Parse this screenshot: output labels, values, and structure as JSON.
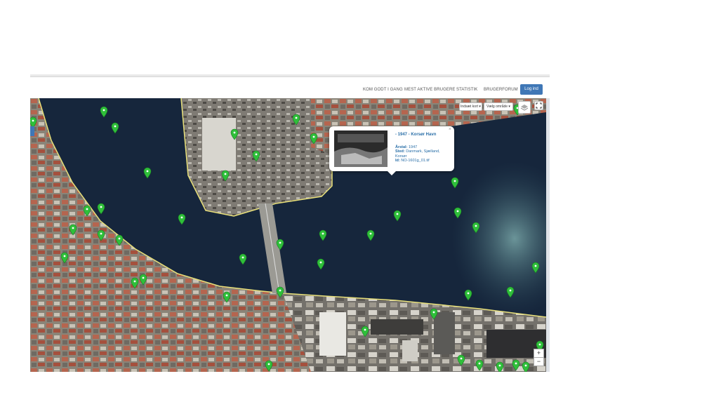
{
  "navbar": {
    "links": [
      "KOM GODT I GANG",
      "MEST AKTIVE BRUGERE",
      "STATISTIK",
      "BRUGERFORUM"
    ],
    "login_label": "Log ind"
  },
  "map_controls": {
    "dropdown_1": "Indsæt kort",
    "dropdown_2": "Vælg område",
    "zoom_in": "+",
    "zoom_out": "−",
    "fullscreen_icon": "fullscreen-icon",
    "layers_icon": "layers-icon"
  },
  "popup": {
    "title": "- 1947 - Korsør Havn",
    "year_label": "Årstal:",
    "year": "1947",
    "place_label": "Sted:",
    "place": "Danmark, Sjælland, Korsør",
    "id_label": "Id:",
    "id": "NO-1601g_01.tif",
    "close": "×"
  },
  "colors": {
    "water": "#14243a",
    "pin": "#2fbf3a",
    "accent": "#3f77b6",
    "boundary": "#e8e07a"
  }
}
